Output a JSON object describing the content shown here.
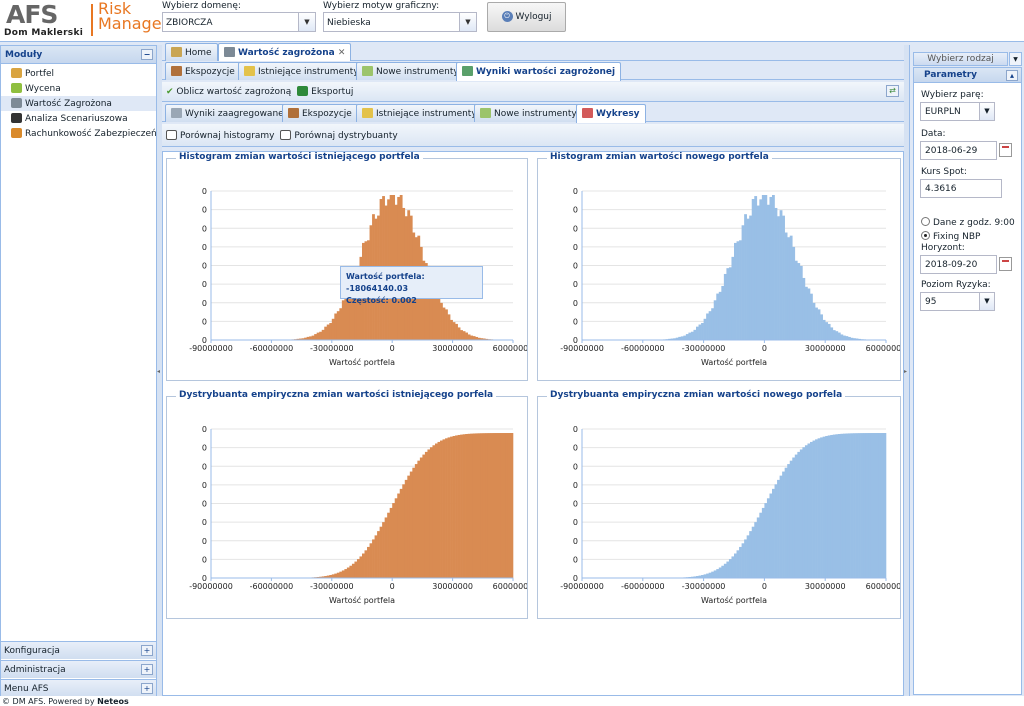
{
  "header": {
    "logo_text": "AFS",
    "logo_sub": "Dom Maklerski",
    "product_line1": "Risk",
    "product_line2": "Manager",
    "domain_label": "Wybierz domenę:",
    "domain_value": "ZBIORCZA",
    "theme_label": "Wybierz motyw graficzny:",
    "theme_value": "Niebieska",
    "logout_label": "Wyloguj"
  },
  "left": {
    "title": "Moduły",
    "items": [
      {
        "label": "Portfel",
        "color": "#d9a441"
      },
      {
        "label": "Wycena",
        "color": "#8fbf3f"
      },
      {
        "label": "Wartość Zagrożona",
        "color": "#7d8a96"
      },
      {
        "label": "Analiza Scenariuszowa",
        "color": "#333333"
      },
      {
        "label": "Rachunkowość Zabezpieczeń",
        "color": "#d98a2b"
      }
    ],
    "accordion": [
      "Konfiguracja",
      "Administracja",
      "Menu AFS"
    ]
  },
  "tabs": {
    "top": [
      "Home",
      "Wartość zagrożona"
    ],
    "second": [
      "Ekspozycje",
      "Istniejące instrumenty",
      "Nowe instrumenty",
      "Wyniki wartości zagrożonej"
    ],
    "toolbar": [
      "Oblicz wartość zagrożoną",
      "Eksportuj"
    ],
    "third": [
      "Wyniki zaagregowane",
      "Ekspozycje",
      "Istniejące instrumenty",
      "Nowe instrumenty",
      "Wykresy"
    ],
    "chart_toolbar": [
      "Porównaj histogramy",
      "Porównaj dystrybuanty"
    ]
  },
  "tooltip": {
    "line1": "Wartość portfela: -18064140.03",
    "line2": "Częstość: 0.002"
  },
  "chart_data": [
    {
      "type": "bar",
      "title": "Histogram zmian wartości istniejącego portfela",
      "xlabel": "Wartość portfela",
      "xlim": [
        -90000000,
        60000000
      ],
      "xticks": [
        "-90000000",
        "-60000000",
        "-30000000",
        "0",
        "30000000",
        "60000000"
      ],
      "yticks": [
        "0",
        "0",
        "0",
        "0",
        "0",
        "0",
        "0",
        "0",
        "0"
      ],
      "distribution": "normal",
      "mean": 0,
      "std": 15000000,
      "color": "#d98b52"
    },
    {
      "type": "bar",
      "title": "Histogram zmian wartości nowego portfela",
      "xlabel": "Wartość portfela",
      "xlim": [
        -90000000,
        60000000
      ],
      "xticks": [
        "-90000000",
        "-60000000",
        "-30000000",
        "0",
        "30000000",
        "60000000"
      ],
      "yticks": [
        "0",
        "0",
        "0",
        "0",
        "0",
        "0",
        "0",
        "0",
        "0"
      ],
      "distribution": "normal",
      "mean": 0,
      "std": 15000000,
      "color": "#99bfe6"
    },
    {
      "type": "area",
      "title": "Dystrybuanta empiryczna zmian wartości istniejącego porfela",
      "xlabel": "Wartość portfela",
      "xlim": [
        -90000000,
        60000000
      ],
      "xticks": [
        "-90000000",
        "-60000000",
        "-30000000",
        "0",
        "30000000",
        "60000000"
      ],
      "yticks": [
        "0",
        "0",
        "0",
        "0",
        "0",
        "0",
        "0",
        "0",
        "0"
      ],
      "distribution": "normal-cdf",
      "mean": 0,
      "std": 15000000,
      "color": "#d98b52"
    },
    {
      "type": "area",
      "title": "Dystrybuanta empiryczna zmian wartości nowego porfela",
      "xlabel": "Wartość portfela",
      "xlim": [
        -90000000,
        60000000
      ],
      "xticks": [
        "-90000000",
        "-60000000",
        "-30000000",
        "0",
        "30000000",
        "60000000"
      ],
      "yticks": [
        "0",
        "0",
        "0",
        "0",
        "0",
        "0",
        "0",
        "0",
        "0"
      ],
      "distribution": "normal-cdf",
      "mean": 0,
      "std": 15000000,
      "color": "#99bfe6"
    }
  ],
  "right": {
    "select_label": "Wybierz rodzaj",
    "title": "Parametry",
    "pair_label": "Wybierz parę:",
    "pair_value": "EURPLN",
    "date_label": "Data:",
    "date_value": "2018-06-29",
    "spot_label": "Kurs Spot:",
    "spot_value": "4.3616",
    "radio1": "Dane z godz. 9:00",
    "radio2": "Fixing NBP",
    "horizon_label": "Horyzont:",
    "horizon_value": "2018-09-20",
    "risk_label": "Poziom Ryzyka:",
    "risk_value": "95"
  },
  "footer": {
    "text": "© DM AFS. Powered by ",
    "brand": "Neteos"
  }
}
